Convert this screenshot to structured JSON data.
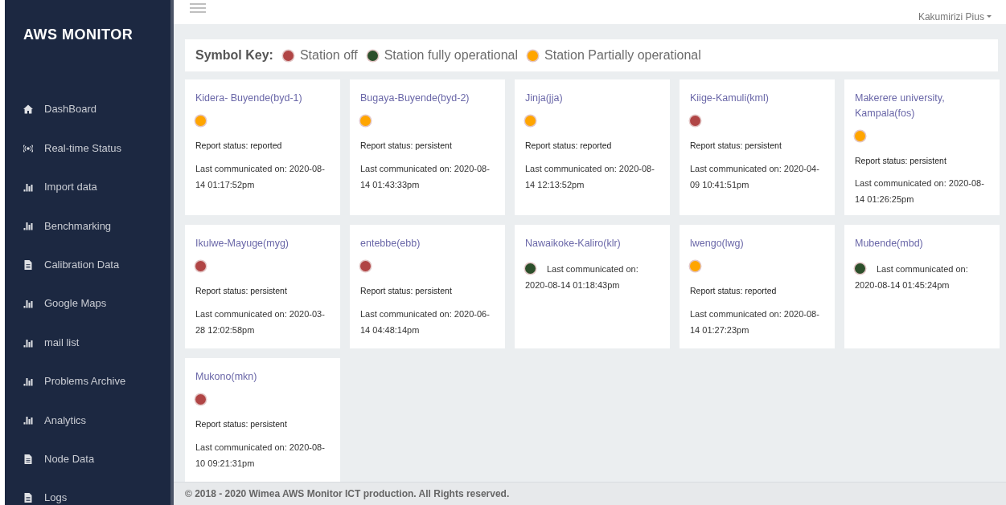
{
  "sidebar": {
    "brand": "AWS MONITOR",
    "items": [
      {
        "label": "DashBoard",
        "kind": "home"
      },
      {
        "label": "Real-time Status",
        "kind": "signal"
      },
      {
        "label": "Import data",
        "kind": "chart"
      },
      {
        "label": "Benchmarking",
        "kind": "chart"
      },
      {
        "label": "Calibration Data",
        "kind": "file"
      },
      {
        "label": "Google Maps",
        "kind": "chart"
      },
      {
        "label": "mail list",
        "kind": "chart"
      },
      {
        "label": "Problems Archive",
        "kind": "chart"
      },
      {
        "label": "Analytics",
        "kind": "chart"
      },
      {
        "label": "Node Data",
        "kind": "file"
      },
      {
        "label": "Logs",
        "kind": "file"
      }
    ]
  },
  "header": {
    "user": "Kakumirizi Pius"
  },
  "symbol_key": {
    "title": "Symbol Key:",
    "items": [
      {
        "label": "Station off",
        "color": "#b04545"
      },
      {
        "label": "Station fully operational",
        "color": "#2d4f2b"
      },
      {
        "label": "Station Partially operational",
        "color": "#ffa500"
      }
    ]
  },
  "stations": [
    {
      "name": "Kidera- Buyende(byd-1)",
      "color": "#ffa500",
      "report_status": "Report status: reported",
      "last_communicated": "Last communicated on: 2020-08-14 01:17:52pm"
    },
    {
      "name": "Bugaya-Buyende(byd-2)",
      "color": "#ffa500",
      "report_status": "Report status: persistent",
      "last_communicated": "Last communicated on: 2020-08-14 01:43:33pm"
    },
    {
      "name": "Jinja(jja)",
      "color": "#ffa500",
      "report_status": "Report status: reported",
      "last_communicated": "Last communicated on: 2020-08-14 12:13:52pm"
    },
    {
      "name": "Kiige-Kamuli(kml)",
      "color": "#b04545",
      "report_status": "Report status: persistent",
      "last_communicated": "Last communicated on: 2020-04-09 10:41:51pm"
    },
    {
      "name": "Makerere university, Kampala(fos)",
      "color": "#ffa500",
      "report_status": "Report status: persistent",
      "last_communicated": "Last communicated on: 2020-08-14 01:26:25pm"
    },
    {
      "name": "Ikulwe-Mayuge(myg)",
      "color": "#b04545",
      "report_status": "Report status: persistent",
      "last_communicated": "Last communicated on: 2020-03-28 12:02:58pm"
    },
    {
      "name": "entebbe(ebb)",
      "color": "#b04545",
      "report_status": "Report status: persistent",
      "last_communicated": "Last communicated on: 2020-06-14 04:48:14pm"
    },
    {
      "name": "Nawaikoke-Kaliro(klr)",
      "color": "#2d4f2b",
      "last_communicated": "Last communicated on: 2020-08-14 01:18:43pm"
    },
    {
      "name": "lwengo(lwg)",
      "color": "#ffa500",
      "report_status": "Report status: reported",
      "last_communicated": "Last communicated on: 2020-08-14 01:27:23pm"
    },
    {
      "name": "Mubende(mbd)",
      "color": "#2d4f2b",
      "last_communicated": "Last communicated on: 2020-08-14 01:45:24pm"
    },
    {
      "name": "Mukono(mkn)",
      "color": "#b04545",
      "report_status": "Report status: persistent",
      "last_communicated": "Last communicated on: 2020-08-10 09:21:31pm"
    }
  ],
  "footer": {
    "text": "© 2018 - 2020 Wimea AWS Monitor ICT production. All Rights reserved."
  }
}
